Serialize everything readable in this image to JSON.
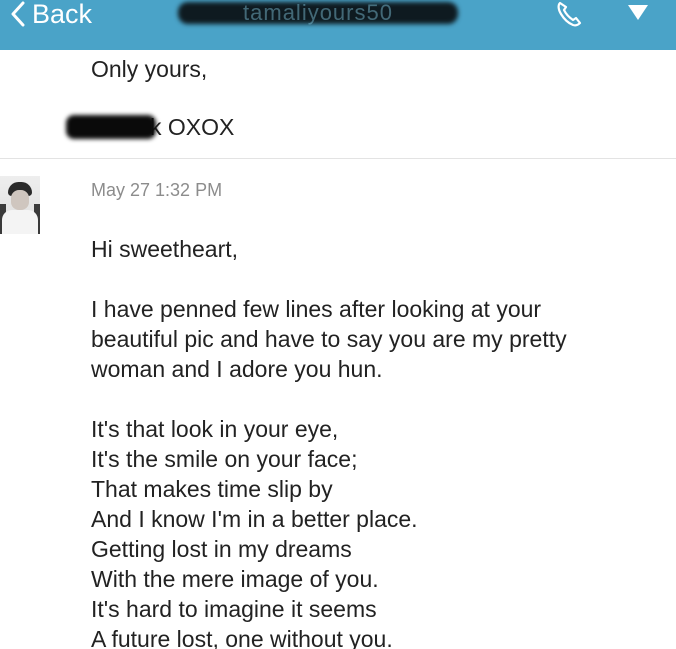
{
  "header": {
    "back_label": "Back",
    "title_redacted": "tamaliyours50",
    "background_color": "#4aa3c8"
  },
  "previous_message": {
    "closing": "Only yours,",
    "signoff_visible": "k OXOX"
  },
  "message": {
    "timestamp": "May 27 1:32 PM",
    "lines": [
      "Hi sweetheart,",
      "I have penned few lines after looking at your",
      "beautiful pic and have to say you are my pretty",
      "woman and I adore you hun.",
      "It's that look in your eye,",
      "It's the smile on your face;",
      "That makes time slip by",
      "And I know I'm in a better place.",
      "Getting lost in my dreams",
      "With the mere image of you.",
      "It's hard to imagine it seems",
      "A future lost, one without you."
    ]
  },
  "icons": {
    "back": "chevron-left-icon",
    "call": "phone-icon",
    "menu": "triangle-down-icon"
  }
}
